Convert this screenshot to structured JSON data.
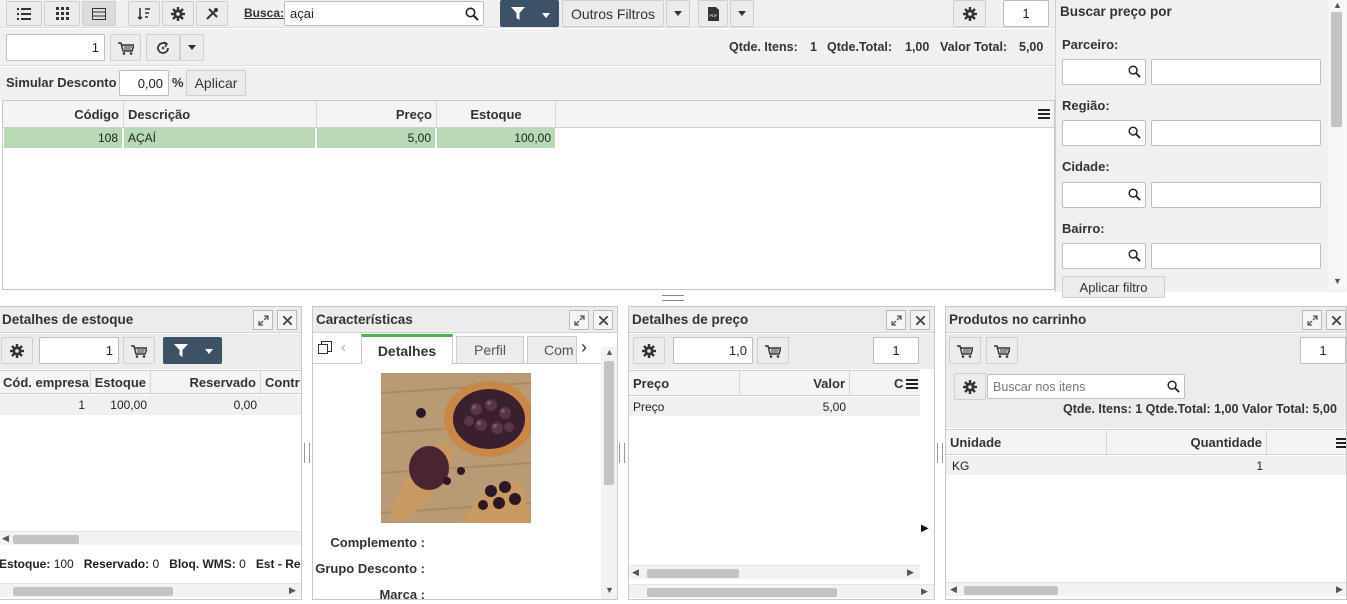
{
  "toolbar": {
    "busca_label": "Busca:",
    "busca_value": "açai",
    "outros_filtros": "Outros Filtros",
    "page_number": "1"
  },
  "row2": {
    "quantity": "1",
    "summary_qtde_itens_label": "Qtde. Itens:",
    "summary_qtde_itens": "1",
    "summary_qtde_total_label": "Qtde.Total:",
    "summary_qtde_total": "1,00",
    "summary_valor_total_label": "Valor Total:",
    "summary_valor_total": "5,00"
  },
  "desconto": {
    "label": "Simular Desconto",
    "value": "0,00",
    "percent": "%",
    "apply": "Aplicar"
  },
  "main_grid": {
    "headers": [
      "Código",
      "Descrição",
      "Preço",
      "Estoque"
    ],
    "rows": [
      {
        "codigo": "108",
        "descricao": "AÇAÍ",
        "preco": "5,00",
        "estoque": "100,00"
      }
    ]
  },
  "price_search": {
    "title": "Buscar preço por",
    "fields": [
      "Parceiro:",
      "Região:",
      "Cidade:",
      "Bairro:"
    ],
    "apply": "Aplicar filtro"
  },
  "estoque_panel": {
    "title": "Detalhes de estoque",
    "quantity": "1",
    "headers": [
      "Cód. empresa",
      "Estoque",
      "Reservado",
      "Contr"
    ],
    "row": {
      "cod": "1",
      "estoque": "100,00",
      "reservado": "0,00"
    },
    "footer": {
      "estoque_label": "Estoque:",
      "estoque": "100",
      "reservado_label": "Reservado:",
      "reservado": "0",
      "bloq_label": "Bloq. WMS:",
      "bloq": "0",
      "est_label": "Est - Re"
    }
  },
  "caract_panel": {
    "title": "Características",
    "tabs": [
      "Detalhes",
      "Perfil",
      "Com"
    ],
    "fields": [
      "Complemento :",
      "Grupo Desconto :",
      "Marca :"
    ]
  },
  "preco_panel": {
    "title": "Detalhes de preço",
    "quantity": "1,0",
    "page_number": "1",
    "headers": [
      "Preço",
      "Valor",
      "C"
    ],
    "row": {
      "preco": "Preço",
      "valor": "5,00"
    }
  },
  "carrinho_panel": {
    "title": "Produtos no carrinho",
    "page_number": "1",
    "search_placeholder": "Buscar nos itens",
    "summary": "Qtde. Itens: 1 Qtde.Total: 1,00 Valor Total: 5,00",
    "headers": [
      "Unidade",
      "Quantidade"
    ],
    "row": {
      "unidade": "KG",
      "quantidade": "1"
    }
  },
  "colors": {
    "accent_dark": "#3d5266",
    "row_selected": "#b5d9b5",
    "tab_active": "#4caf50"
  }
}
